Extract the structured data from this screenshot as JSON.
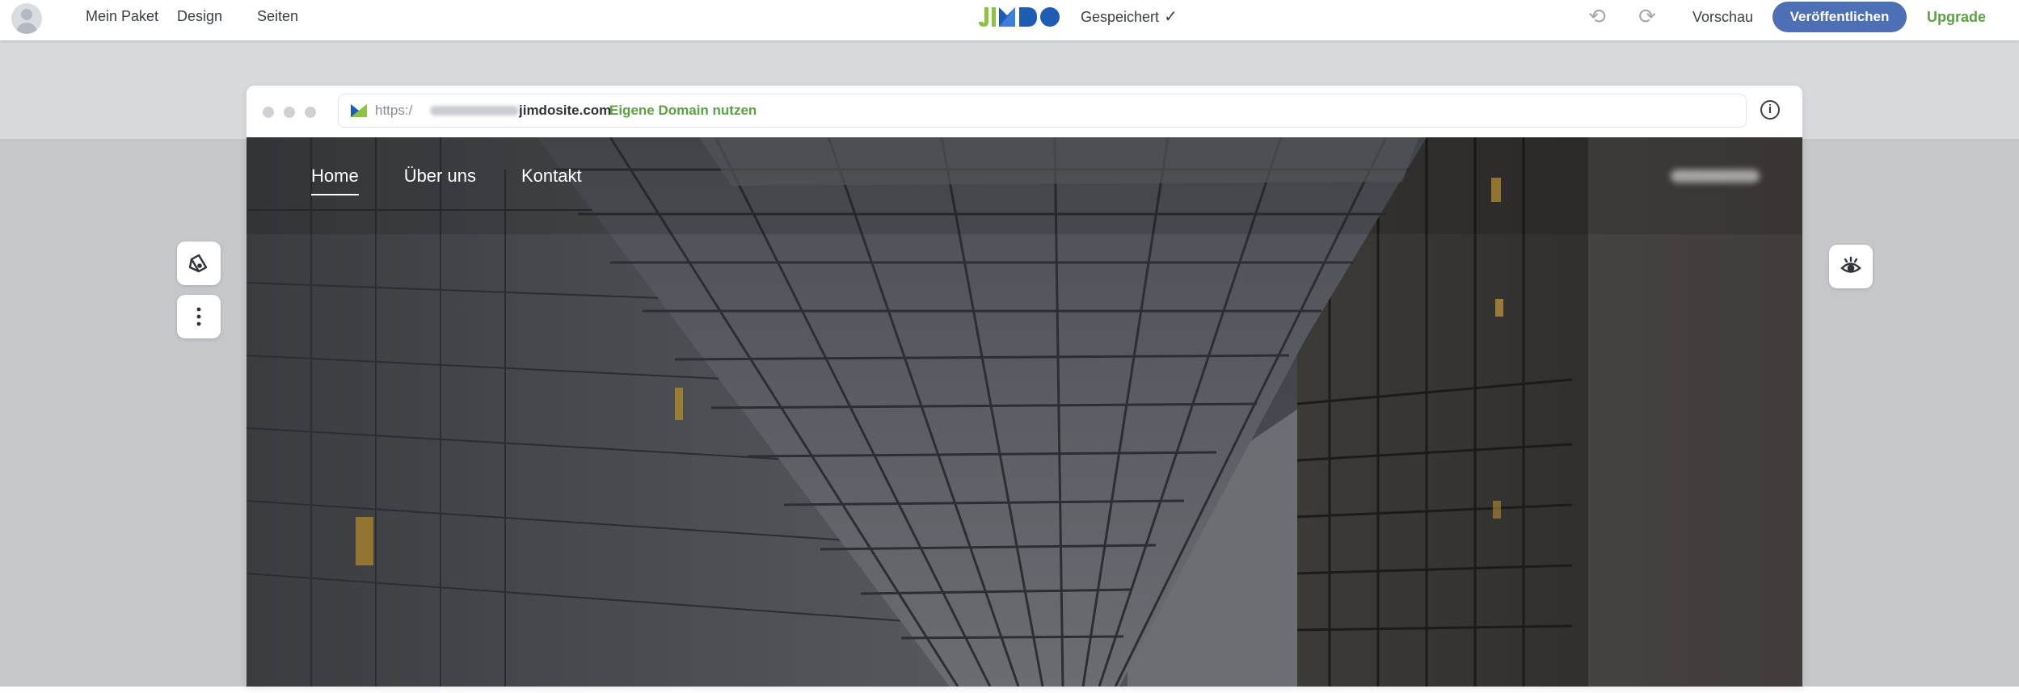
{
  "topbar": {
    "nav": [
      "Mein Paket",
      "Design",
      "Seiten"
    ],
    "logo_text": "JIMDO",
    "status": "Gespeichert",
    "preview": "Vorschau",
    "publish": "Veröffentlichen",
    "upgrade": "Upgrade"
  },
  "browser": {
    "url_prefix": "https:/",
    "url_domain": "jimdosite.com",
    "custom_domain": "Eigene Domain nutzen",
    "info": "i"
  },
  "site": {
    "nav": [
      "Home",
      "Über uns",
      "Kontakt"
    ]
  },
  "colors": {
    "accent": "#4d6fb6",
    "upgrade": "#5ba344",
    "logo_green": "#8bc53f",
    "logo_blue": "#1e5db3"
  },
  "icons": {
    "design": "paint-palette-icon",
    "more": "vertical-dots-icon",
    "visibility": "eye-icon",
    "undo": "undo-icon",
    "redo": "redo-icon"
  }
}
